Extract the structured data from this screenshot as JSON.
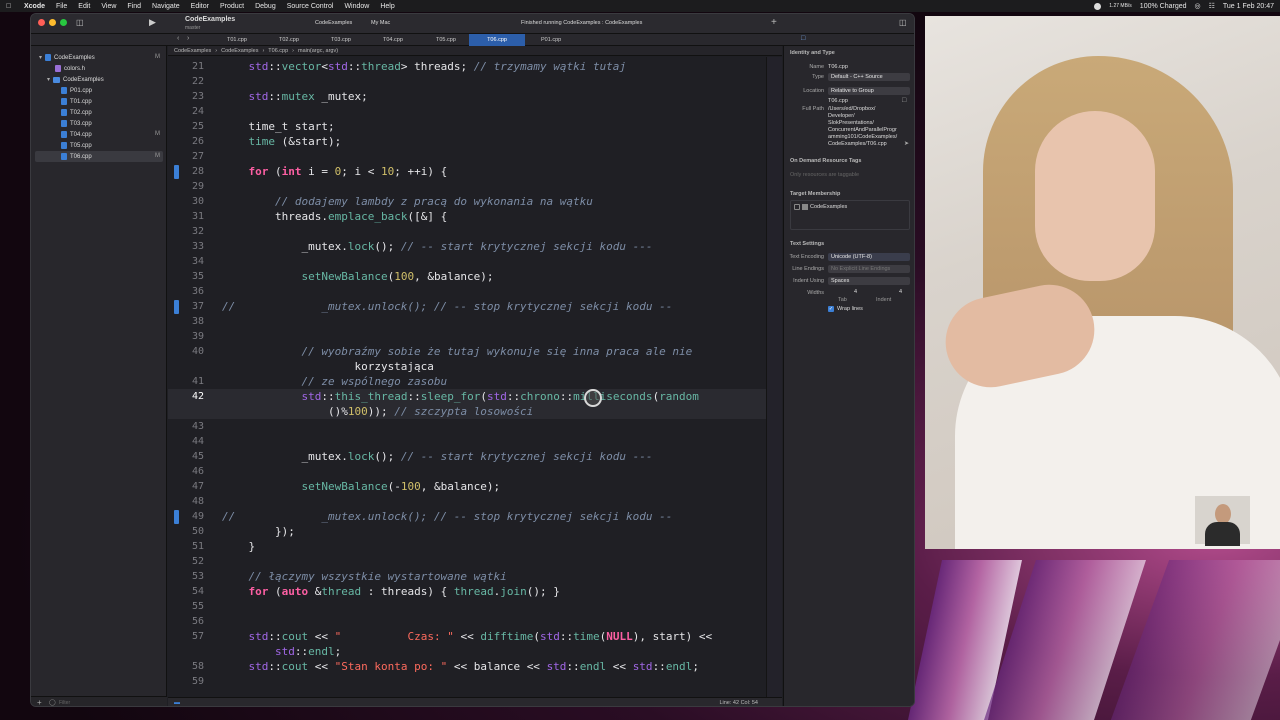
{
  "menubar": {
    "items": [
      "Xcode",
      "File",
      "Edit",
      "View",
      "Find",
      "Navigate",
      "Editor",
      "Product",
      "Debug",
      "Source Control",
      "Window",
      "Help"
    ],
    "battery": "100% Charged",
    "net": "1.27 MB/s",
    "clock": "Tue 1 Feb  20:47"
  },
  "window": {
    "project": "CodeExamples",
    "branch": "master",
    "scheme": "CodeExamples",
    "destination": "My Mac",
    "status": "Finished running CodeExamples : CodeExamples",
    "tabs": [
      "T01.cpp",
      "T02.cpp",
      "T03.cpp",
      "T04.cpp",
      "T05.cpp",
      "T06.cpp",
      "P01.cpp"
    ],
    "active_tab": "T06.cpp"
  },
  "navigator": {
    "root": "CodeExamples",
    "root_badge": "M",
    "items": [
      {
        "name": "colors.h",
        "badge": ""
      },
      {
        "name": "CodeExamples",
        "badge": ""
      },
      {
        "name": "P01.cpp",
        "badge": ""
      },
      {
        "name": "T01.cpp",
        "badge": ""
      },
      {
        "name": "T02.cpp",
        "badge": ""
      },
      {
        "name": "T03.cpp",
        "badge": ""
      },
      {
        "name": "T04.cpp",
        "badge": "M"
      },
      {
        "name": "T05.cpp",
        "badge": ""
      },
      {
        "name": "T06.cpp",
        "badge": "M"
      }
    ],
    "filter_placeholder": "Filter"
  },
  "jumpbar": [
    "CodeExamples",
    "CodeExamples",
    "T06.cpp",
    "main(argc, argv)"
  ],
  "code": {
    "current_line": "42",
    "lines": [
      {
        "n": "21",
        "text": "    std::vector<std::thread> threads; // trzymamy wątki tutaj",
        "bp": false
      },
      {
        "n": "22",
        "text": "",
        "bp": false
      },
      {
        "n": "23",
        "text": "    std::mutex _mutex;",
        "bp": false
      },
      {
        "n": "24",
        "text": "",
        "bp": false
      },
      {
        "n": "25",
        "text": "    time_t start;",
        "bp": false
      },
      {
        "n": "26",
        "text": "    time (&start);",
        "bp": false
      },
      {
        "n": "27",
        "text": "",
        "bp": false
      },
      {
        "n": "28",
        "text": "    for (int i = 0; i < 10; ++i) {",
        "bp": true
      },
      {
        "n": "29",
        "text": "",
        "bp": false
      },
      {
        "n": "30",
        "text": "        // dodajemy lambdy z pracą do wykonania na wątku",
        "bp": false
      },
      {
        "n": "31",
        "text": "        threads.emplace_back([&] {",
        "bp": false
      },
      {
        "n": "32",
        "text": "",
        "bp": false
      },
      {
        "n": "33",
        "text": "            _mutex.lock(); // -- start krytycznej sekcji kodu ---",
        "bp": false
      },
      {
        "n": "34",
        "text": "",
        "bp": false
      },
      {
        "n": "35",
        "text": "            setNewBalance(100, &balance);",
        "bp": false
      },
      {
        "n": "36",
        "text": "",
        "bp": false
      },
      {
        "n": "37",
        "text": "//             _mutex.unlock(); // -- stop krytycznej sekcji kodu --",
        "bp": true
      },
      {
        "n": "38",
        "text": "",
        "bp": false
      },
      {
        "n": "39",
        "text": "",
        "bp": false
      },
      {
        "n": "40",
        "text": "            // wyobraźmy sobie że tutaj wykonuje się inna praca ale nie",
        "bp": false
      },
      {
        "n": "",
        "text": "                    korzystająca",
        "bp": false
      },
      {
        "n": "41",
        "text": "            // ze wspólnego zasobu",
        "bp": false
      },
      {
        "n": "42",
        "text": "            std::this_thread::sleep_for(std::chrono::milliseconds(random",
        "bp": false
      },
      {
        "n": "",
        "text": "                ()%100)); // szczypta losowości",
        "bp": false
      },
      {
        "n": "43",
        "text": "",
        "bp": false
      },
      {
        "n": "44",
        "text": "",
        "bp": false
      },
      {
        "n": "45",
        "text": "            _mutex.lock(); // -- start krytycznej sekcji kodu ---",
        "bp": false
      },
      {
        "n": "46",
        "text": "",
        "bp": false
      },
      {
        "n": "47",
        "text": "            setNewBalance(-100, &balance);",
        "bp": false
      },
      {
        "n": "48",
        "text": "",
        "bp": false
      },
      {
        "n": "49",
        "text": "//             _mutex.unlock(); // -- stop krytycznej sekcji kodu --",
        "bp": true
      },
      {
        "n": "50",
        "text": "        });",
        "bp": false
      },
      {
        "n": "51",
        "text": "    }",
        "bp": false
      },
      {
        "n": "52",
        "text": "",
        "bp": false
      },
      {
        "n": "53",
        "text": "    // łączymy wszystkie wystartowane wątki",
        "bp": false
      },
      {
        "n": "54",
        "text": "    for (auto &thread : threads) { thread.join(); }",
        "bp": false
      },
      {
        "n": "55",
        "text": "",
        "bp": false
      },
      {
        "n": "56",
        "text": "",
        "bp": false
      },
      {
        "n": "57",
        "text": "    std::cout << \"          Czas: \" << difftime(std::time(NULL), start) <<",
        "bp": false
      },
      {
        "n": "",
        "text": "        std::endl;",
        "bp": false
      },
      {
        "n": "58",
        "text": "    std::cout << \"Stan konta po: \" << balance << std::endl << std::endl;",
        "bp": false
      },
      {
        "n": "59",
        "text": "",
        "bp": false
      }
    ]
  },
  "status": {
    "position": "Line: 42  Col: 54"
  },
  "inspector": {
    "identity_header": "Identity and Type",
    "name_label": "Name",
    "name": "T06.cpp",
    "type_label": "Type",
    "type": "Default - C++ Source",
    "location_label": "Location",
    "location": "Relative to Group",
    "location_file": "T06.cpp",
    "fullpath_label": "Full Path",
    "fullpath": [
      "/Users/ed/Dropbox/",
      "Developer/",
      "SlokPresentations/",
      "ConcurrentAndParallelProgr",
      "amming101/CodeExamples/",
      "CodeExamples/T06.cpp"
    ],
    "odr_header": "On Demand Resource Tags",
    "odr_placeholder": "Only resources are taggable",
    "target_header": "Target Membership",
    "target": "CodeExamples",
    "text_header": "Text Settings",
    "encoding_label": "Text Encoding",
    "encoding": "Unicode (UTF-8)",
    "endings_label": "Line Endings",
    "endings": "No Explicit Line Endings",
    "indent_label": "Indent Using",
    "indent": "Spaces",
    "widths_label": "Widths",
    "tab_width": "4",
    "indent_width": "4",
    "tab_label": "Tab",
    "indent_sub_label": "Indent",
    "wrap_label": "Wrap lines"
  }
}
